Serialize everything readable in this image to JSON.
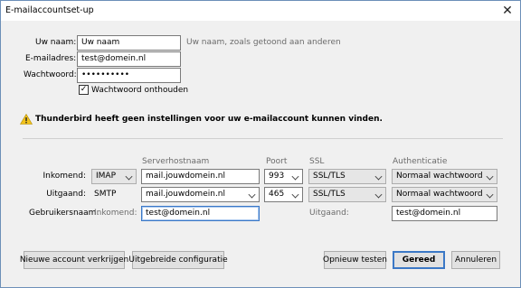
{
  "window": {
    "title": "E-mailaccountset-up",
    "close_symbol": "✕"
  },
  "form": {
    "name_label": "Uw naam:",
    "name_value": "Uw naam",
    "name_hint": "Uw naam, zoals getoond aan anderen",
    "email_label": "E-mailadres:",
    "email_value": "test@domein.nl",
    "password_label": "Wachtwoord:",
    "password_value": "••••••••••",
    "remember_label": "Wachtwoord onthouden",
    "remember_checked": true
  },
  "warning": {
    "icon": "warning-icon",
    "text": "Thunderbird heeft geen instellingen voor uw e-mailaccount kunnen vinden."
  },
  "server_table": {
    "headers": {
      "hostname": "Serverhostnaam",
      "port": "Poort",
      "ssl": "SSL",
      "auth": "Authenticatie"
    },
    "incoming": {
      "label": "Inkomend:",
      "protocol": "IMAP",
      "hostname": "mail.jouwdomein.nl",
      "port": "993",
      "ssl": "SSL/TLS",
      "auth": "Normaal wachtwoord"
    },
    "outgoing": {
      "label": "Uitgaand:",
      "protocol": "SMTP",
      "hostname": "mail.jouwdomein.nl",
      "port": "465",
      "ssl": "SSL/TLS",
      "auth": "Normaal wachtwoord"
    },
    "username": {
      "label": "Gebruikersnaam:",
      "incoming_label": "Inkomend:",
      "incoming_value": "test@domein.nl",
      "outgoing_label": "Uitgaand:",
      "outgoing_value": "test@domein.nl"
    }
  },
  "buttons": {
    "new_account": "Nieuwe account verkrijgen",
    "advanced": "Uitgebreide configuratie",
    "retest": "Opnieuw testen",
    "done": "Gereed",
    "cancel": "Annuleren"
  },
  "colors": {
    "accent": "#3b78c6",
    "warning": "#f2c21b"
  }
}
